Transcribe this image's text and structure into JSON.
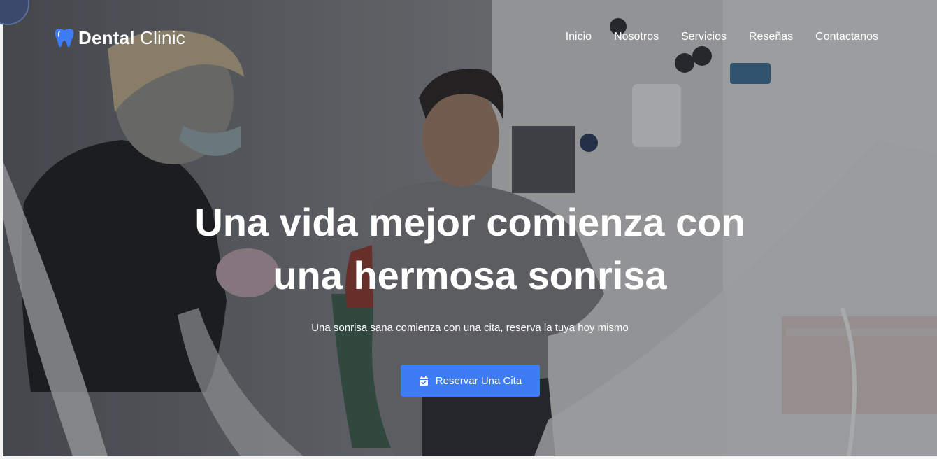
{
  "brand": {
    "name_bold": "Dental",
    "name_light": "Clinic",
    "icon": "tooth-icon",
    "accent": "#3e7cf6"
  },
  "nav": {
    "items": [
      {
        "label": "Inicio"
      },
      {
        "label": "Nosotros"
      },
      {
        "label": "Servicios"
      },
      {
        "label": "Reseñas"
      },
      {
        "label": "Contactanos"
      }
    ]
  },
  "hero": {
    "headline_line1": "Una vida mejor comienza con",
    "headline_line2": "una hermosa sonrisa",
    "subtitle": "Una sonrisa sana comienza con una cita, reserva la tuya hoy mismo",
    "cta_label": "Reservar Una Cita",
    "cta_icon": "calendar-check-icon",
    "cta_color": "#3e7cf6"
  }
}
